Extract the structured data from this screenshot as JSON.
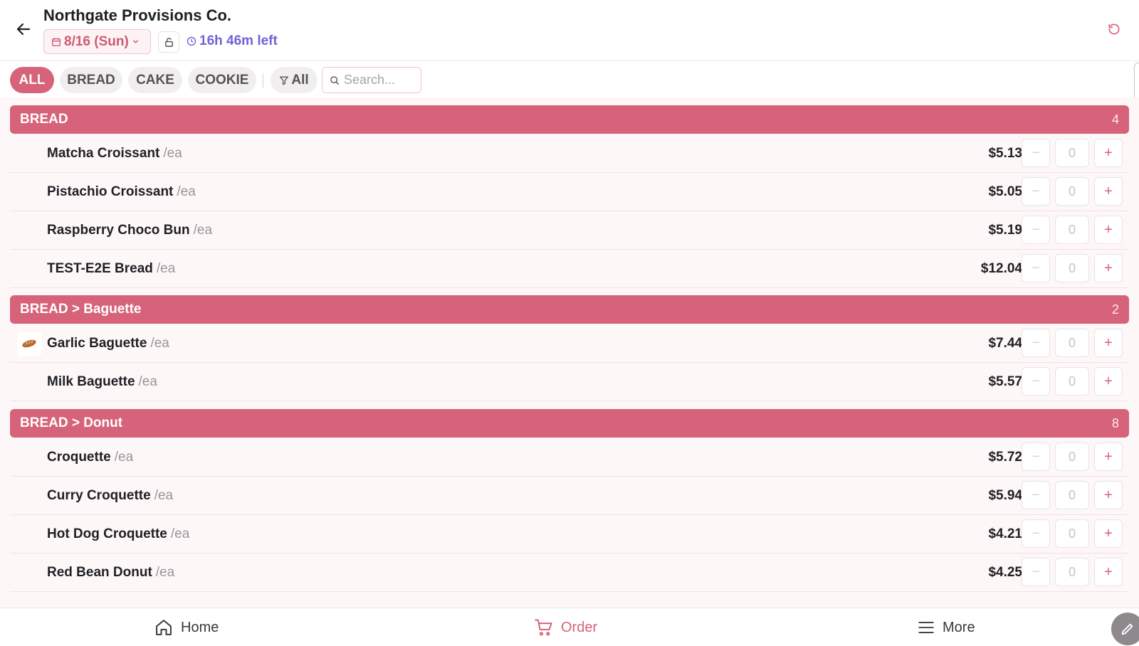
{
  "header": {
    "title": "Northgate Provisions Co.",
    "date_label": "8/16 (Sun)",
    "time_left": "16h 46m left"
  },
  "filters": {
    "categories": [
      "ALL",
      "BREAD",
      "CAKE",
      "COOKIE"
    ],
    "active": "ALL",
    "filter_label": "All",
    "search_placeholder": "Search..."
  },
  "groups": [
    {
      "title": "BREAD",
      "count": "4",
      "items": [
        {
          "name": "Matcha Croissant",
          "unit": "/ea",
          "price": "$5.13",
          "qty": "0"
        },
        {
          "name": "Pistachio Croissant",
          "unit": "/ea",
          "price": "$5.05",
          "qty": "0"
        },
        {
          "name": "Raspberry Choco Bun",
          "unit": "/ea",
          "price": "$5.19",
          "qty": "0"
        },
        {
          "name": "TEST-E2E Bread",
          "unit": "/ea",
          "price": "$12.04",
          "qty": "0"
        }
      ]
    },
    {
      "title": "BREAD > Baguette",
      "count": "2",
      "items": [
        {
          "name": "Garlic Baguette",
          "unit": "/ea",
          "price": "$7.44",
          "qty": "0"
        },
        {
          "name": "Milk Baguette",
          "unit": "/ea",
          "price": "$5.57",
          "qty": "0"
        }
      ]
    },
    {
      "title": "BREAD > Donut",
      "count": "8",
      "items": [
        {
          "name": "Croquette",
          "unit": "/ea",
          "price": "$5.72",
          "qty": "0"
        },
        {
          "name": "Curry Croquette",
          "unit": "/ea",
          "price": "$5.94",
          "qty": "0"
        },
        {
          "name": "Hot Dog Croquette",
          "unit": "/ea",
          "price": "$4.21",
          "qty": "0"
        },
        {
          "name": "Red Bean Donut",
          "unit": "/ea",
          "price": "$4.25",
          "qty": "0"
        }
      ]
    }
  ],
  "qty_controls": {
    "minus": "−",
    "plus": "+"
  },
  "nav": {
    "home": "Home",
    "order": "Order",
    "more": "More"
  },
  "colors": {
    "accent": "#d6637a",
    "time_accent": "#6f63d8",
    "list_bg": "#fdf7f8"
  }
}
